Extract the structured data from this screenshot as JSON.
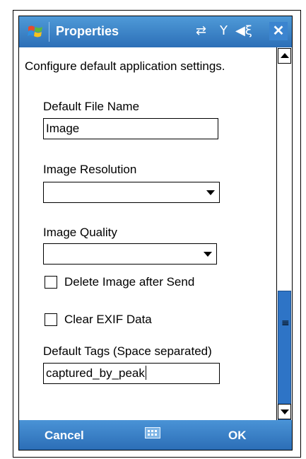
{
  "window": {
    "title": "Properties",
    "close_label": "✕",
    "status_icons": {
      "connectivity": "⇄",
      "signal": "Y",
      "volume": "◀ξ"
    }
  },
  "form": {
    "description": "Configure default application settings.",
    "default_file_name": {
      "label": "Default File Name",
      "value": "Image"
    },
    "image_resolution": {
      "label": "Image Resolution",
      "value": ""
    },
    "image_quality": {
      "label": "Image Quality",
      "value": ""
    },
    "delete_after_send": {
      "label": "Delete Image after Send",
      "checked": false
    },
    "clear_exif": {
      "label": "Clear EXIF Data",
      "checked": false
    },
    "default_tags": {
      "label": "Default Tags (Space separated)",
      "value": "captured_by_peak"
    }
  },
  "menubar": {
    "left": "Cancel",
    "right": "OK"
  },
  "colors": {
    "titlebar": "#2c6fb7",
    "menubar": "#2a6cb5",
    "scroll_thumb": "#2e74c6",
    "accent_line": "#2ea1d6"
  },
  "icons": {
    "logo": "windows-flag-icon",
    "keyboard": "keyboard-icon",
    "grip": "scroll-grip-icon"
  }
}
